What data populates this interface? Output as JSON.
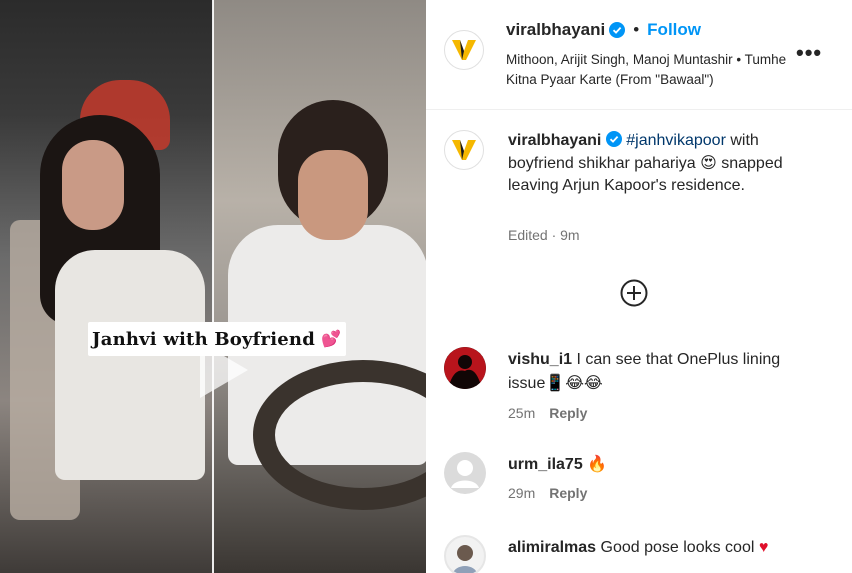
{
  "media": {
    "caption": "Janhvi with Boyfriend",
    "caption_emoji": "💕"
  },
  "header": {
    "username": "viralbhayani",
    "follow_label": "Follow",
    "separator": "•",
    "audio_line": "Mithoon, Arijit Singh, Manoj Muntashir • Tumhe Kitna Pyaar Karte (From \"Bawaal\")",
    "more_label": "•••"
  },
  "post": {
    "username": "viralbhayani",
    "hashtag": "#janhvikapoor",
    "text": " with boyfriend shikhar pahariya 😍 snapped leaving Arjun Kapoor's residence.",
    "meta": "Edited · 9m"
  },
  "comments": [
    {
      "username": "vishu_i1",
      "text": "I can see that OnePlus lining issue📱😂😂",
      "time": "25m",
      "reply": "Reply"
    },
    {
      "username": "urm_ila75",
      "text": "🔥",
      "time": "29m",
      "reply": "Reply"
    },
    {
      "username": "alimiralmas",
      "text": "Good pose looks cool",
      "heart": "♥"
    }
  ],
  "colors": {
    "link": "#0095f6",
    "hashtag": "#00376b",
    "muted": "#737373"
  }
}
